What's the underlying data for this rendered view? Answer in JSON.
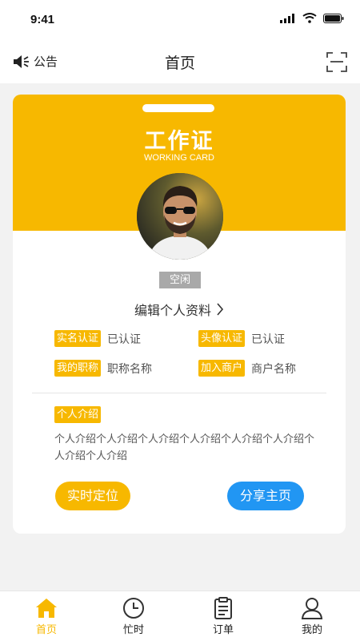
{
  "status_bar": {
    "time": "9:41"
  },
  "nav": {
    "notice_label": "公告",
    "title": "首页"
  },
  "card": {
    "title": "工作证",
    "subtitle": "WORKING CARD",
    "status_badge": "空闲",
    "edit_profile": "编辑个人资料",
    "info": [
      {
        "tag": "实名认证",
        "value": "已认证"
      },
      {
        "tag": "头像认证",
        "value": "已认证"
      },
      {
        "tag": "我的职称",
        "value": "职称名称"
      },
      {
        "tag": "加入商户",
        "value": "商户名称"
      }
    ],
    "intro_tag": "个人介绍",
    "intro_text": "个人介绍个人介绍个人介绍个人介绍个人介绍个人介绍个人介绍个人介绍",
    "locate_button": "实时定位",
    "share_button": "分享主页"
  },
  "tabs": [
    {
      "label": "首页",
      "icon": "home-icon",
      "active": true
    },
    {
      "label": "忙时",
      "icon": "clock-icon",
      "active": false
    },
    {
      "label": "订单",
      "icon": "clipboard-icon",
      "active": false
    },
    {
      "label": "我的",
      "icon": "user-icon",
      "active": false
    }
  ],
  "colors": {
    "accent": "#f7b800",
    "share": "#2196f3",
    "badge": "#a9a9a9"
  }
}
